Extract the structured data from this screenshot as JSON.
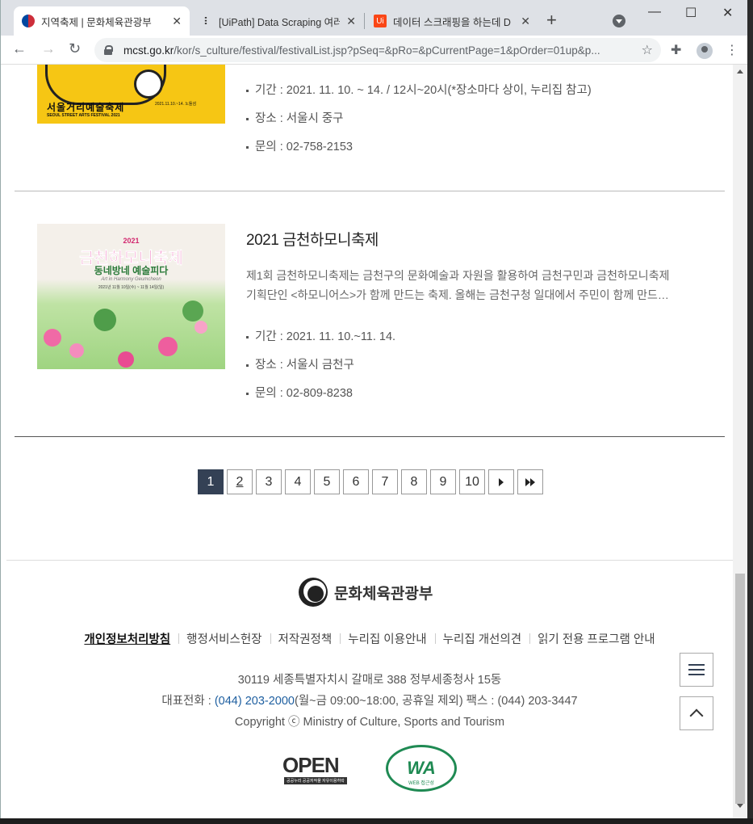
{
  "browser": {
    "tabs": [
      {
        "title": "지역축제 | 문화체육관광부",
        "active": true
      },
      {
        "title": "[UiPath] Data Scraping 여러",
        "active": false
      },
      {
        "title": "데이터 스크래핑을 하는데 D",
        "active": false
      }
    ],
    "favicon_text_ui": "Ui",
    "url_host": "mcst.go.kr",
    "url_path": "/kor/s_culture/festival/festivalList.jsp?pSeq=&pRo=&pCurrentPage=1&pOrder=01up&p..."
  },
  "festivals": [
    {
      "thumb_title": "서울거리예술축제",
      "thumb_subtitle": "SEOUL STREET ARTS FESTIVAL 2021",
      "thumb_date": "2021.11.10.~14. 노들섬",
      "period": "기간 : 2021. 11. 10. ~ 14. / 12시~20시(*장소마다 상이, 누리집 참고)",
      "place": "장소 : 서울시 중구",
      "contact": "문의 : 02-758-2153"
    },
    {
      "thumb_year": "2021",
      "thumb_title": "금천하모니축제",
      "thumb_subtitle": "동네방네 예술피다",
      "thumb_slogan": "Art in Harmony Geumcheon",
      "thumb_info": "2021년 11월 10일(수) ~ 11월 14일(일)",
      "title": "2021 금천하모니축제",
      "description_line1": "제1회 금천하모니축제는 금천구의 문화예술과 자원을 활용하여 금천구민과 금천하모니축제",
      "description_line2": "기획단인 <하모니어스>가 함께 만드는 축제. 올해는 금천구청 일대에서 주민이 함께 만드…",
      "period": "기간 : 2021. 11. 10.~11. 14.",
      "place": "장소 : 서울시 금천구",
      "contact": "문의 : 02-809-8238"
    }
  ],
  "pagination": {
    "pages": [
      "1",
      "2",
      "3",
      "4",
      "5",
      "6",
      "7",
      "8",
      "9",
      "10"
    ],
    "current": "1"
  },
  "footer": {
    "org_name": "문화체육관광부",
    "links": [
      "개인정보처리방침",
      "행정서비스헌장",
      "저작권정책",
      "누리집 이용안내",
      "누리집 개선의견",
      "읽기 전용 프로그램 안내"
    ],
    "address": "30119 세종특별자치시 갈매로 388 정부세종청사 15동",
    "phone_label": "대표전화 : ",
    "phone_number": "(044) 203-2000",
    "phone_hours": "(월~금 09:00~18:00, 공휴일 제외)  팩스 : (044) 203-3447",
    "copyright": "Copyright ⓒ Ministry of Culture, Sports and Tourism",
    "open_badge": "OPEN",
    "open_badge_sub": "공공누리  공공저작물 자유이용허락",
    "wa_badge": "WA",
    "wa_badge_sub": "WEB 접근성"
  },
  "colors": {
    "active_page": "#344155",
    "phone_link": "#1e5fa0",
    "festival1_thumb_bg": "#f6c614",
    "festival2_title": "#e9349a"
  }
}
